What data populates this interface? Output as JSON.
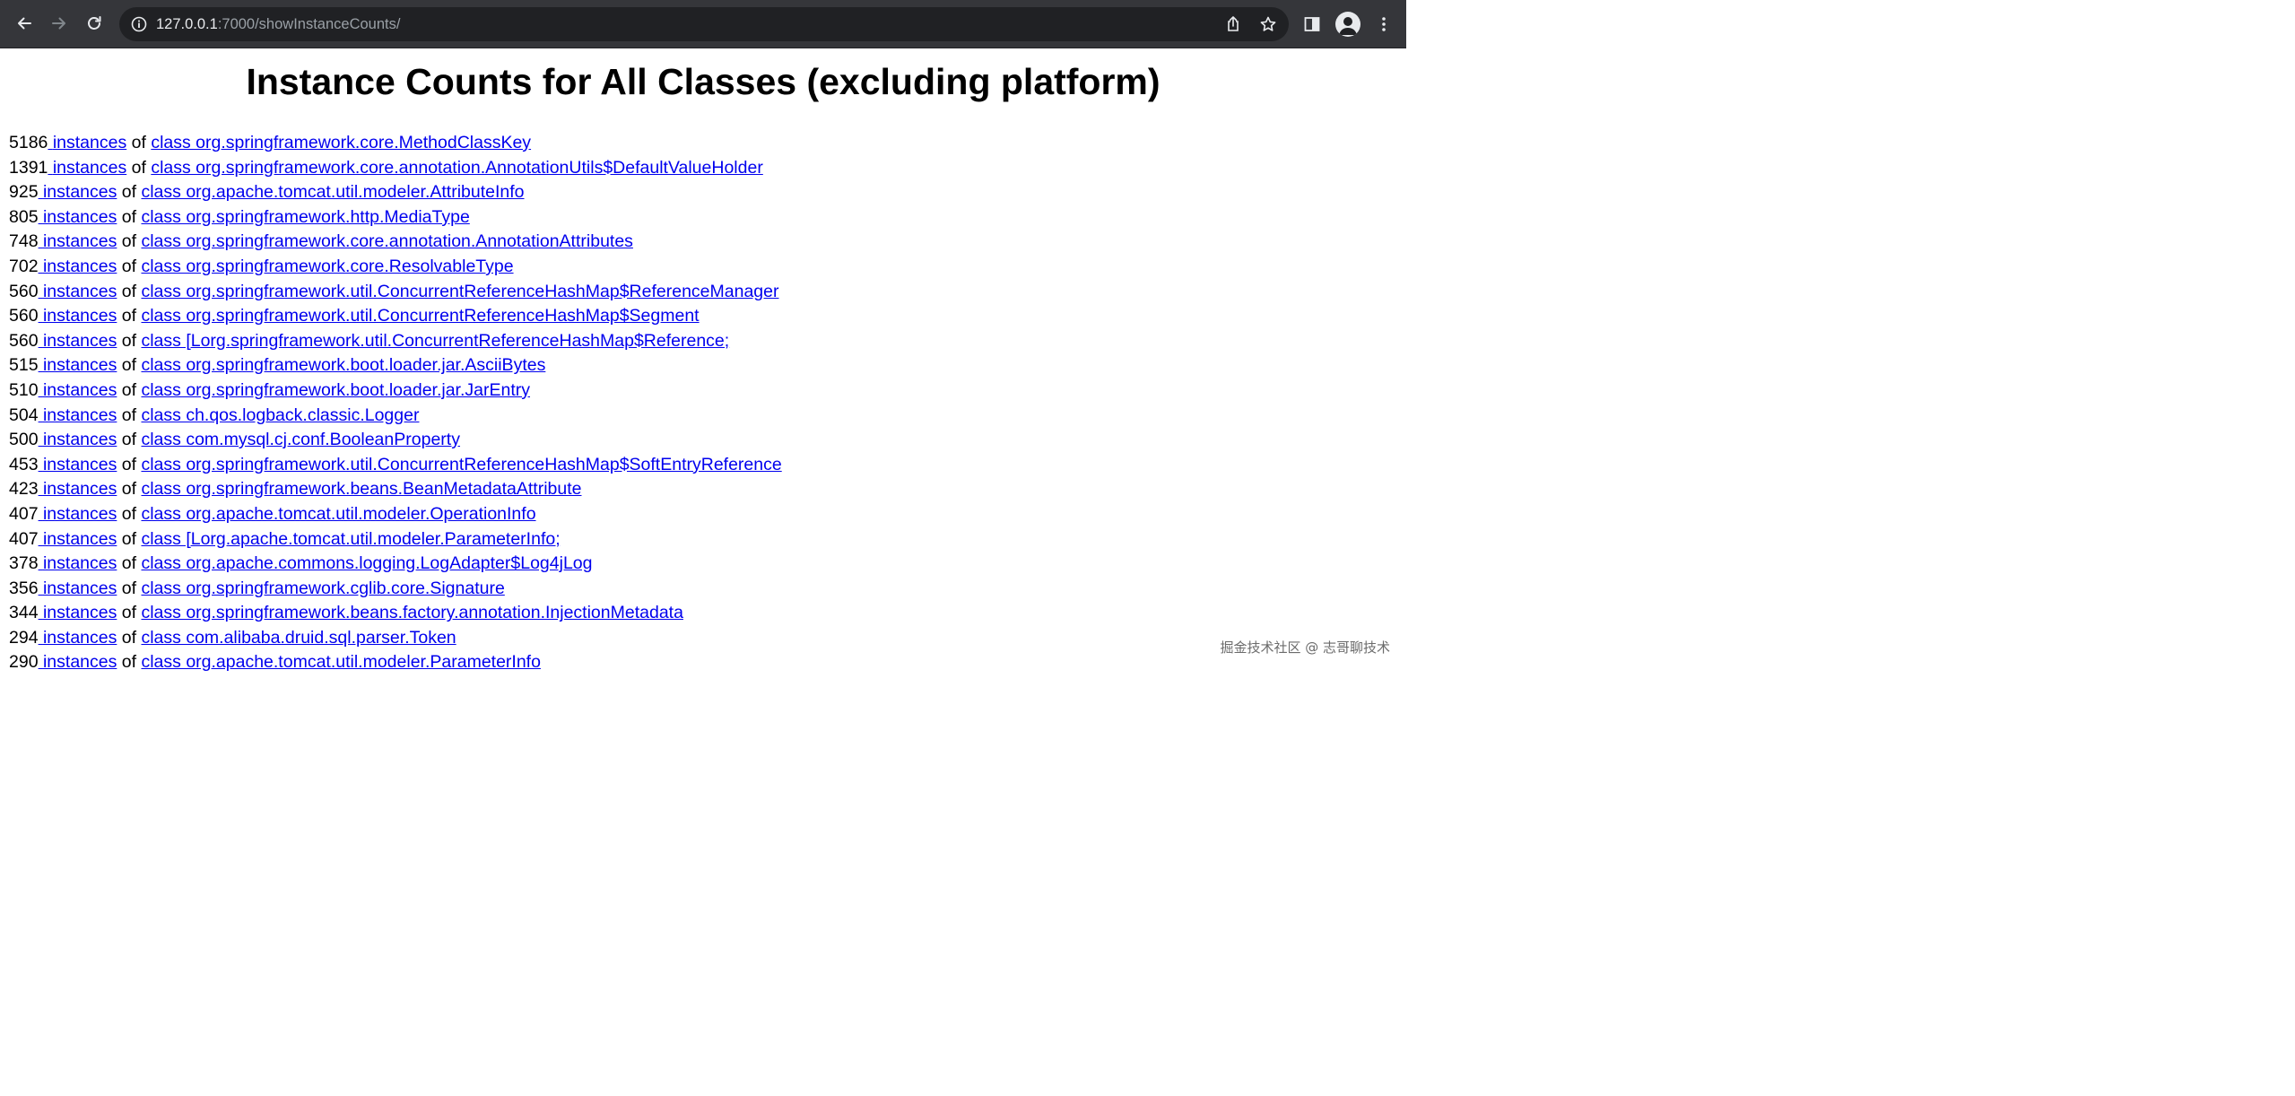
{
  "browser": {
    "url_host": "127.0.0.1",
    "url_rest": ":7000/showInstanceCounts/"
  },
  "page": {
    "title": "Instance Counts for All Classes (excluding platform)",
    "instances_label": "instances",
    "of_label": "of",
    "rows": [
      {
        "count": "5186",
        "cls": "class org.springframework.core.MethodClassKey"
      },
      {
        "count": "1391",
        "cls": "class org.springframework.core.annotation.AnnotationUtils$DefaultValueHolder"
      },
      {
        "count": "925",
        "cls": "class org.apache.tomcat.util.modeler.AttributeInfo"
      },
      {
        "count": "805",
        "cls": "class org.springframework.http.MediaType"
      },
      {
        "count": "748",
        "cls": "class org.springframework.core.annotation.AnnotationAttributes"
      },
      {
        "count": "702",
        "cls": "class org.springframework.core.ResolvableType"
      },
      {
        "count": "560",
        "cls": "class org.springframework.util.ConcurrentReferenceHashMap$ReferenceManager"
      },
      {
        "count": "560",
        "cls": "class org.springframework.util.ConcurrentReferenceHashMap$Segment"
      },
      {
        "count": "560",
        "cls": "class [Lorg.springframework.util.ConcurrentReferenceHashMap$Reference;"
      },
      {
        "count": "515",
        "cls": "class org.springframework.boot.loader.jar.AsciiBytes"
      },
      {
        "count": "510",
        "cls": "class org.springframework.boot.loader.jar.JarEntry"
      },
      {
        "count": "504",
        "cls": "class ch.qos.logback.classic.Logger"
      },
      {
        "count": "500",
        "cls": "class com.mysql.cj.conf.BooleanProperty"
      },
      {
        "count": "453",
        "cls": "class org.springframework.util.ConcurrentReferenceHashMap$SoftEntryReference"
      },
      {
        "count": "423",
        "cls": "class org.springframework.beans.BeanMetadataAttribute"
      },
      {
        "count": "407",
        "cls": "class org.apache.tomcat.util.modeler.OperationInfo"
      },
      {
        "count": "407",
        "cls": "class [Lorg.apache.tomcat.util.modeler.ParameterInfo;"
      },
      {
        "count": "378",
        "cls": "class org.apache.commons.logging.LogAdapter$Log4jLog"
      },
      {
        "count": "356",
        "cls": "class org.springframework.cglib.core.Signature"
      },
      {
        "count": "344",
        "cls": "class org.springframework.beans.factory.annotation.InjectionMetadata"
      },
      {
        "count": "294",
        "cls": "class com.alibaba.druid.sql.parser.Token"
      },
      {
        "count": "290",
        "cls": "class org.apache.tomcat.util.modeler.ParameterInfo"
      }
    ]
  },
  "watermark": "掘金技术社区 @ 志哥聊技术",
  "colors": {
    "chrome_bg": "#35363a",
    "omnibox_bg": "#202124",
    "link": "#0000ee"
  }
}
